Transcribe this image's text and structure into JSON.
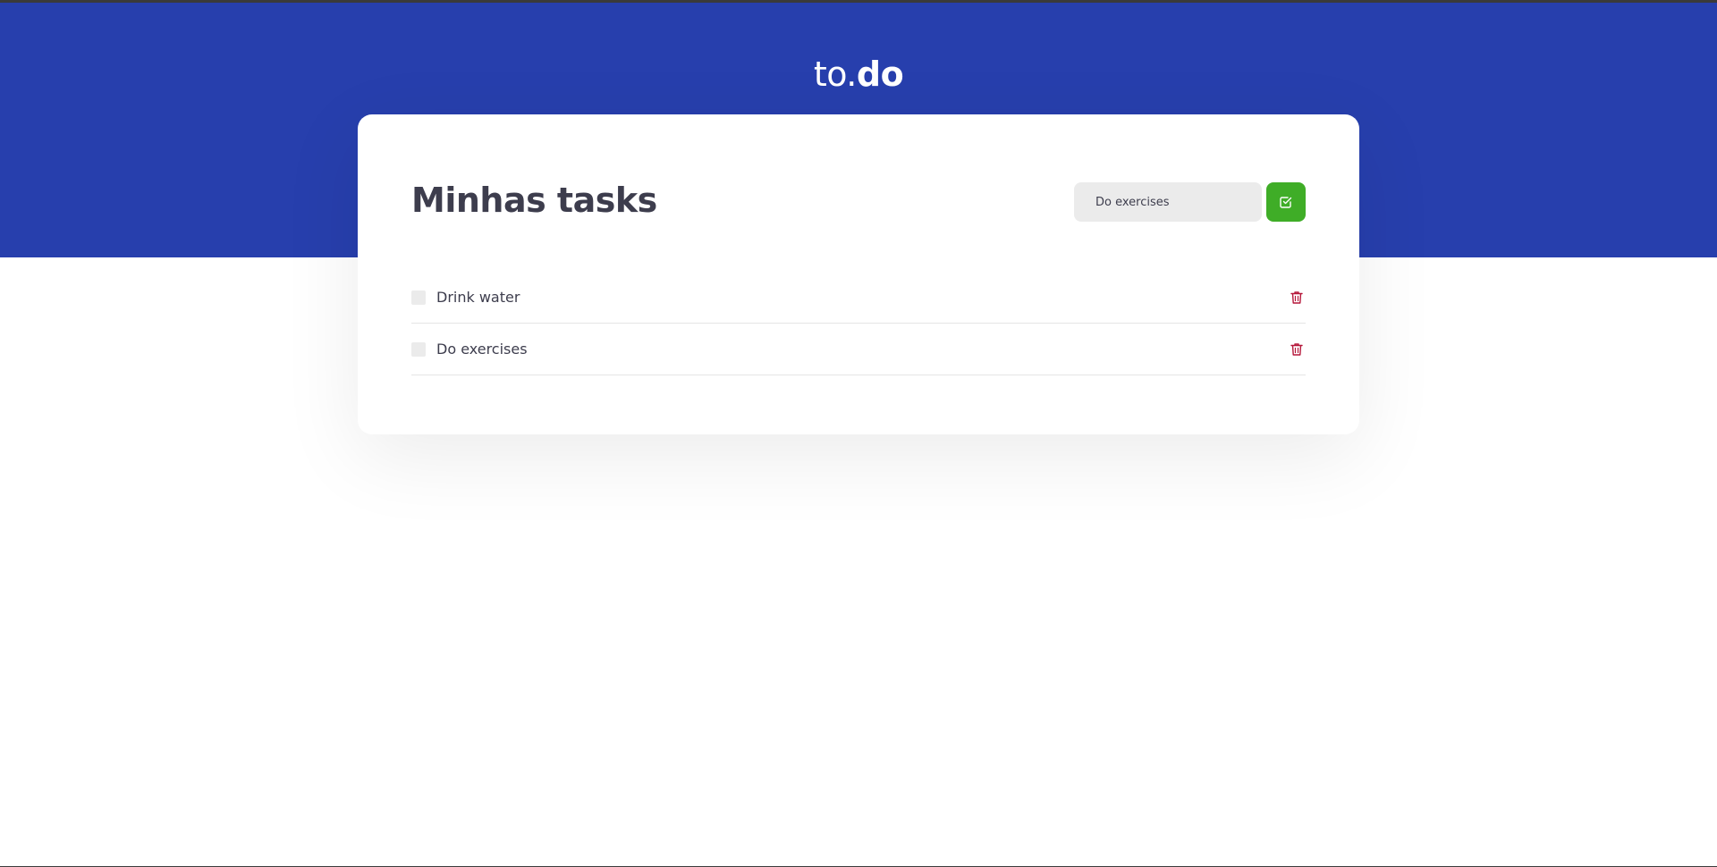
{
  "header": {
    "logo_light": "to.",
    "logo_bold": "do"
  },
  "card": {
    "title": "Minhas tasks",
    "input_value": "Do exercises",
    "add_button_icon": "check-square-icon"
  },
  "tasks": [
    {
      "label": "Drink water",
      "checked": false,
      "delete_icon": "trash-icon"
    },
    {
      "label": "Do exercises",
      "checked": false,
      "delete_icon": "trash-icon"
    }
  ],
  "colors": {
    "brand_blue": "#273fad",
    "add_green": "#3fad27",
    "delete_red": "#b5173a",
    "text_dark": "#3d3d4d",
    "input_bg": "#ebebeb"
  }
}
